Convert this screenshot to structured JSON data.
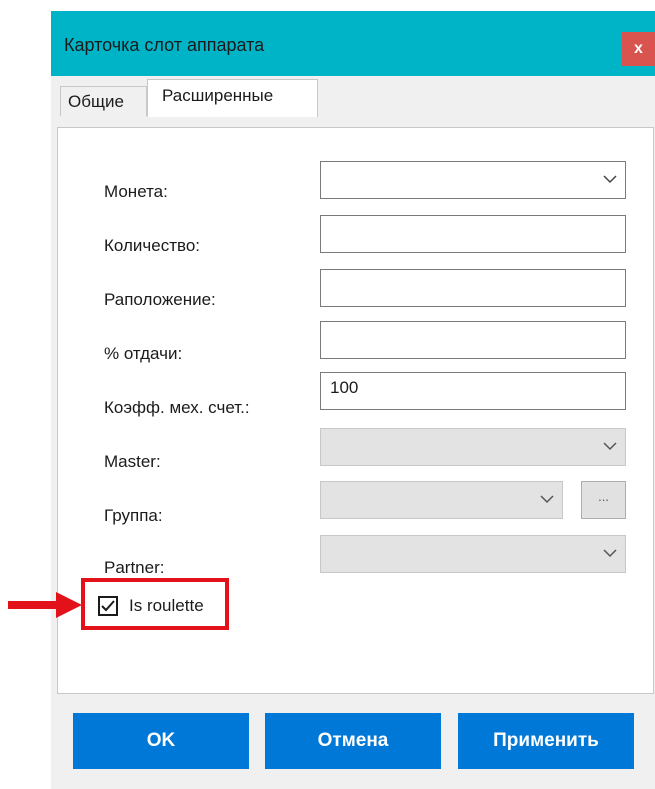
{
  "window": {
    "title": "Карточка слот аппарата",
    "close_label": "x"
  },
  "tabs": [
    {
      "label": "Общие",
      "active": false
    },
    {
      "label": "Расширенные",
      "active": true
    }
  ],
  "fields": {
    "coin": {
      "label": "Монета:",
      "value": "",
      "type": "dropdown",
      "enabled": true
    },
    "quantity": {
      "label": "Количество:",
      "value": "",
      "type": "text",
      "enabled": true
    },
    "location": {
      "label": "Раположение:",
      "value": "",
      "type": "text",
      "enabled": true
    },
    "payout": {
      "label": "% отдачи:",
      "value": "",
      "type": "text",
      "enabled": true
    },
    "coeff": {
      "label": "Коэфф. мех. счет.:",
      "value": "100",
      "type": "text",
      "enabled": true
    },
    "master": {
      "label": "Master:",
      "value": "",
      "type": "dropdown",
      "enabled": false
    },
    "group": {
      "label": "Группа:",
      "value": "",
      "type": "dropdown",
      "enabled": false,
      "extra_button": "..."
    },
    "partner": {
      "label": "Partner:",
      "value": "",
      "type": "dropdown",
      "enabled": false
    }
  },
  "checkbox": {
    "label": "Is roulette",
    "checked": true
  },
  "buttons": {
    "ok": "OK",
    "cancel": "Отмена",
    "apply": "Применить"
  },
  "colors": {
    "titlebar": "#00b4c7",
    "close": "#d9534f",
    "button": "#0078d7",
    "highlight": "#e3121a"
  }
}
